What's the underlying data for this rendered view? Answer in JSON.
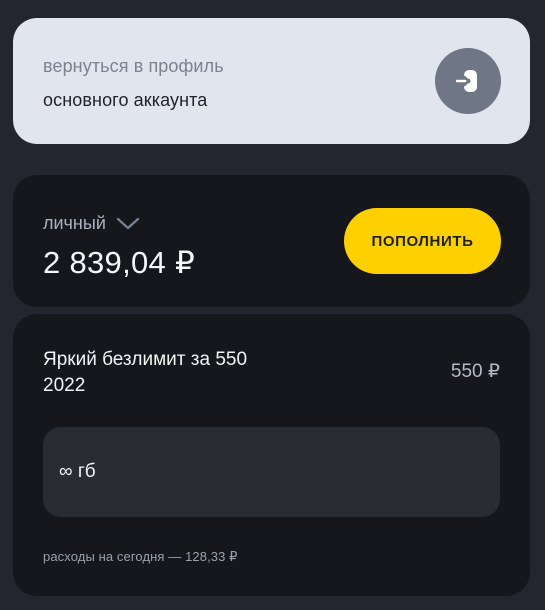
{
  "profile": {
    "line1": "вернуться в профиль",
    "line2": "основного аккаунта",
    "icon": "switch-account-icon"
  },
  "balance": {
    "account_name": "личный",
    "amount": "2 839,04 ₽",
    "topup_label": "пополнить",
    "dropdown_icon": "chevron-down-icon"
  },
  "tariff": {
    "title": "Яркий безлимит за 550 2022",
    "price": "550 ₽",
    "traffic": "∞ гб",
    "expenses": "расходы на сегодня — 128,33 ₽"
  },
  "colors": {
    "background": "#23252f",
    "card_dark": "#16171c",
    "card_light": "#e1e5ed",
    "accent_yellow": "#ffd000"
  }
}
